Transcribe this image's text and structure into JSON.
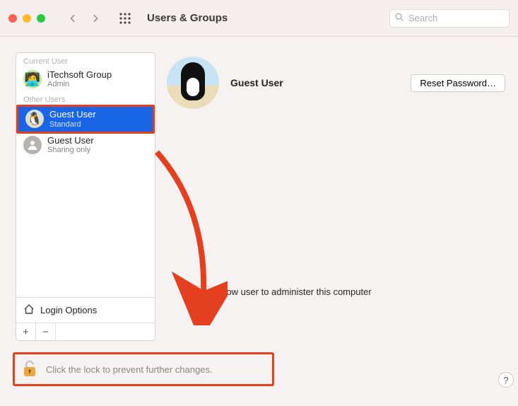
{
  "window": {
    "title": "Users & Groups",
    "search_placeholder": "Search"
  },
  "sidebar": {
    "current_user_label": "Current User",
    "other_users_label": "Other Users",
    "current_user": {
      "name": "iTechsoft Group",
      "role": "Admin"
    },
    "other_users": [
      {
        "name": "Guest User",
        "role": "Standard",
        "selected": true
      },
      {
        "name": "Guest User",
        "role": "Sharing only",
        "selected": false
      }
    ],
    "login_options_label": "Login Options"
  },
  "main": {
    "user_name": "Guest User",
    "reset_password_label": "Reset Password…",
    "admin_checkbox_label": "Allow user to administer this computer",
    "admin_checkbox_checked": false
  },
  "lockbar": {
    "text": "Click the lock to prevent further changes."
  },
  "help_label": "?"
}
